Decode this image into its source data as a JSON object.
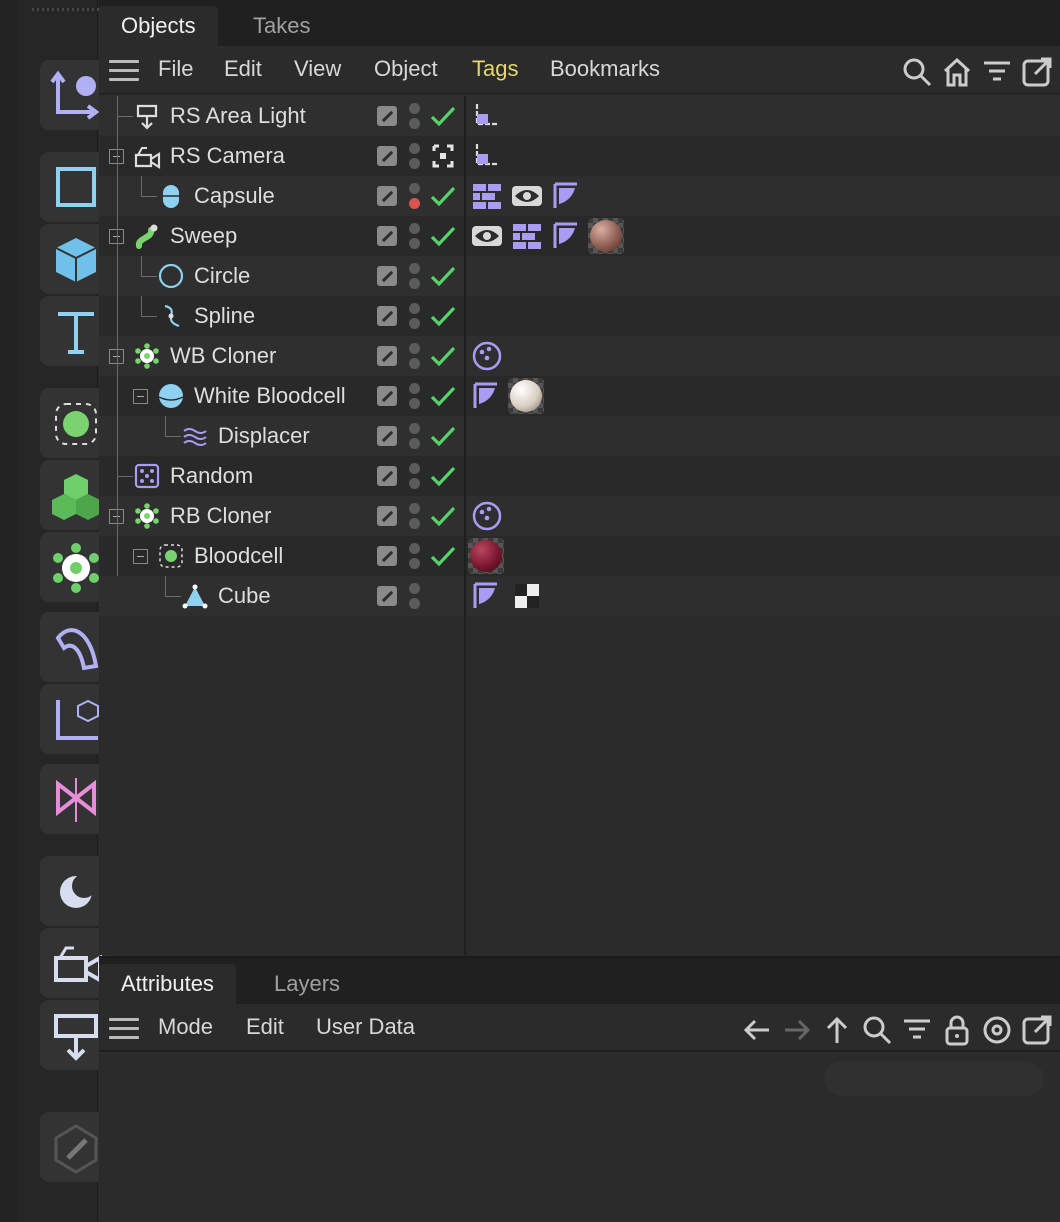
{
  "objects_panel": {
    "tabs": [
      {
        "label": "Objects",
        "active": true
      },
      {
        "label": "Takes",
        "active": false
      }
    ],
    "menu": [
      "File",
      "Edit",
      "View",
      "Object",
      "Tags",
      "Bookmarks"
    ],
    "highlighted_menu": "Tags",
    "right_icons": [
      "search-icon",
      "home-icon",
      "filter-icon",
      "maximize-icon"
    ],
    "rows": [
      {
        "name": "RS Area Light",
        "icon": "area-light-icon",
        "depth": 0,
        "fold": false,
        "check": true,
        "red_dot": false,
        "tags": [
          "target-tag-icon"
        ]
      },
      {
        "name": "RS Camera",
        "icon": "camera-icon",
        "depth": 0,
        "fold": true,
        "check": false,
        "focus": true,
        "red_dot": false,
        "tags": [
          "target-tag-icon"
        ]
      },
      {
        "name": "Capsule",
        "icon": "capsule-icon",
        "depth": 1,
        "fold": false,
        "check": true,
        "red_dot": true,
        "tags": [
          "bricks-tag-icon",
          "eye-tag-icon",
          "uv-tag-icon"
        ]
      },
      {
        "name": "Sweep",
        "icon": "sweep-icon",
        "depth": 0,
        "fold": true,
        "check": true,
        "red_dot": false,
        "tags": [
          "eye-tag-icon",
          "bricks-tag-icon",
          "uv-tag-icon",
          "material-copper"
        ]
      },
      {
        "name": "Circle",
        "icon": "circle-icon",
        "depth": 1,
        "fold": false,
        "check": true,
        "red_dot": false,
        "tags": []
      },
      {
        "name": "Spline",
        "icon": "spline-icon",
        "depth": 1,
        "fold": false,
        "check": true,
        "red_dot": false,
        "tags": []
      },
      {
        "name": "WB Cloner",
        "icon": "cloner-icon",
        "depth": 0,
        "fold": true,
        "check": true,
        "red_dot": false,
        "tags": [
          "motion-tag-icon"
        ]
      },
      {
        "name": "White Bloodcell",
        "icon": "sphere-icon",
        "depth": 1,
        "fold": true,
        "check": true,
        "red_dot": false,
        "tags": [
          "uv-tag-icon",
          "material-white"
        ]
      },
      {
        "name": "Displacer",
        "icon": "displacer-icon",
        "depth": 2,
        "fold": false,
        "check": true,
        "red_dot": false,
        "tags": []
      },
      {
        "name": "Random",
        "icon": "random-icon",
        "depth": 0,
        "fold": false,
        "check": true,
        "red_dot": false,
        "tags": []
      },
      {
        "name": "RB Cloner",
        "icon": "cloner-icon",
        "depth": 0,
        "fold": true,
        "check": true,
        "red_dot": false,
        "tags": [
          "motion-tag-icon"
        ]
      },
      {
        "name": "Bloodcell",
        "icon": "fracture-icon",
        "depth": 1,
        "fold": true,
        "check": true,
        "red_dot": false,
        "tags": [
          "material-red"
        ]
      },
      {
        "name": "Cube",
        "icon": "polygon-icon",
        "depth": 2,
        "fold": false,
        "check": false,
        "red_dot": false,
        "tags": [
          "uv-tag-icon",
          "checker-tag-icon"
        ]
      }
    ]
  },
  "attributes_panel": {
    "tabs": [
      {
        "label": "Attributes",
        "active": true
      },
      {
        "label": "Layers",
        "active": false
      }
    ],
    "menu": [
      "Mode",
      "Edit",
      "User Data"
    ],
    "right_icons": [
      "back-arrow-icon",
      "forward-arrow-icon",
      "up-arrow-icon",
      "search-icon",
      "filter-icon",
      "lock-icon",
      "target-icon",
      "maximize-icon"
    ]
  },
  "toolbar": {
    "buttons": [
      "move-axis-icon",
      "rectangle-icon",
      "cube-icon",
      "text-icon",
      "cloner-select-icon",
      "voxel-icon",
      "gear-cloner-icon",
      "bend-icon",
      "coordinate-icon",
      "symmetry-icon",
      "light-icon",
      "camera-icon",
      "spotlight-icon",
      "edit-icon"
    ]
  },
  "colors": {
    "accent": "#9a8cf0",
    "check": "#58d36a",
    "highlight": "#e3d774"
  }
}
